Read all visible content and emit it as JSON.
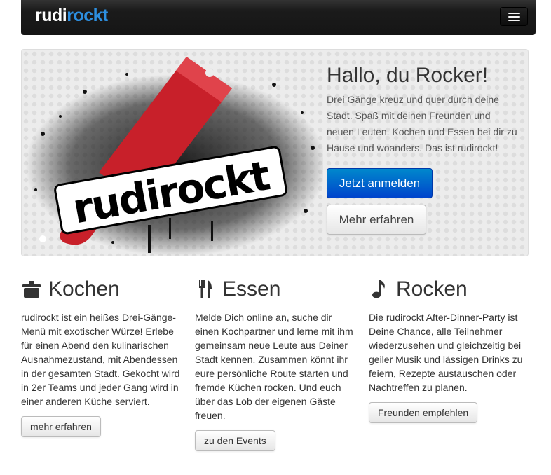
{
  "navbar": {
    "brand_part1": "rudi",
    "brand_part2": "rockt"
  },
  "hero": {
    "logo_text": "rudirockt",
    "title": "Hallo, du Rocker!",
    "text": "Drei Gänge kreuz und quer durch deine Stadt. Spaß mit deinen Freunden und neuen Leuten. Kochen und Essen bei dir zu Hause und woanders. Das ist rudirockt!",
    "primary_button": "Jetzt anmelden",
    "secondary_button": "Mehr erfahren"
  },
  "columns": [
    {
      "icon": "pot-icon",
      "title": "Kochen",
      "text": "rudirockt ist ein heißes Drei-Gänge-Menü mit exotischer Würze! Erlebe für einen Abend den kulinarischen Ausnahmezustand, mit Abendessen in der gesamten Stadt. Gekocht wird in 2er Teams und jeder Gang wird in einer anderen Küche serviert.",
      "button": "mehr erfahren"
    },
    {
      "icon": "cutlery-icon",
      "title": "Essen",
      "text": "Melde Dich online an, suche dir einen Kochpartner und lerne mit ihm gemeinsam neue Leute aus Deiner Stadt kennen. Zusammen könnt ihr eure persönliche Route starten und fremde Küchen rocken. Und euch über das Lob der eigenen Gäste freuen.",
      "button": "zu den Events"
    },
    {
      "icon": "music-note-icon",
      "title": "Rocken",
      "text": "Die rudirockt After-Dinner-Party ist Deine Chance, alle Teilnehmer wiederzusehen und gleichzeitig bei geiler Musik und lässigen Drinks zu feiern, Rezepte austauschen oder Nachtreffen zu planen.",
      "button": "Freunden empfehlen"
    }
  ],
  "colors": {
    "brand_blue": "#2d8fe0",
    "logo_red": "#c8202a",
    "primary": "#0055cc"
  }
}
